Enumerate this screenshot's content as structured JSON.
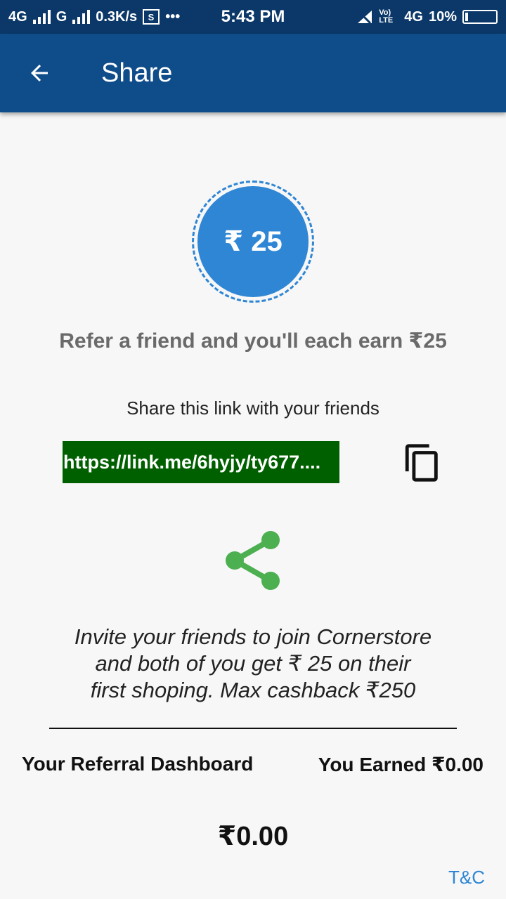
{
  "status_bar": {
    "network1": "4G",
    "network2": "G",
    "speed": "0.3K/s",
    "time": "5:43 PM",
    "volte": "Vo) LTE",
    "network3": "4G",
    "battery": "10%"
  },
  "appbar": {
    "title": "Share"
  },
  "reward": {
    "badge": "₹ 25",
    "headline": "Refer a friend and you'll each earn ₹25"
  },
  "share": {
    "instruction": "Share this link with your friends",
    "link": "https://link.me/6hyjy/ty677...."
  },
  "description": {
    "line1": "Invite your friends to join Cornerstore",
    "line2": "and both of you get ₹ 25 on their",
    "line3": "first shoping. Max cashback ₹250"
  },
  "dashboard": {
    "label": "Your Referral Dashboard",
    "earned": "You Earned ₹0.00",
    "total": "₹0.00"
  },
  "footer": {
    "tnc": "T&C"
  },
  "colors": {
    "appbar": "#0f4c8a",
    "statusbar": "#0b3868",
    "accent_blue": "#2f86d4",
    "link_bg": "#006000",
    "share_green": "#4caf50"
  }
}
